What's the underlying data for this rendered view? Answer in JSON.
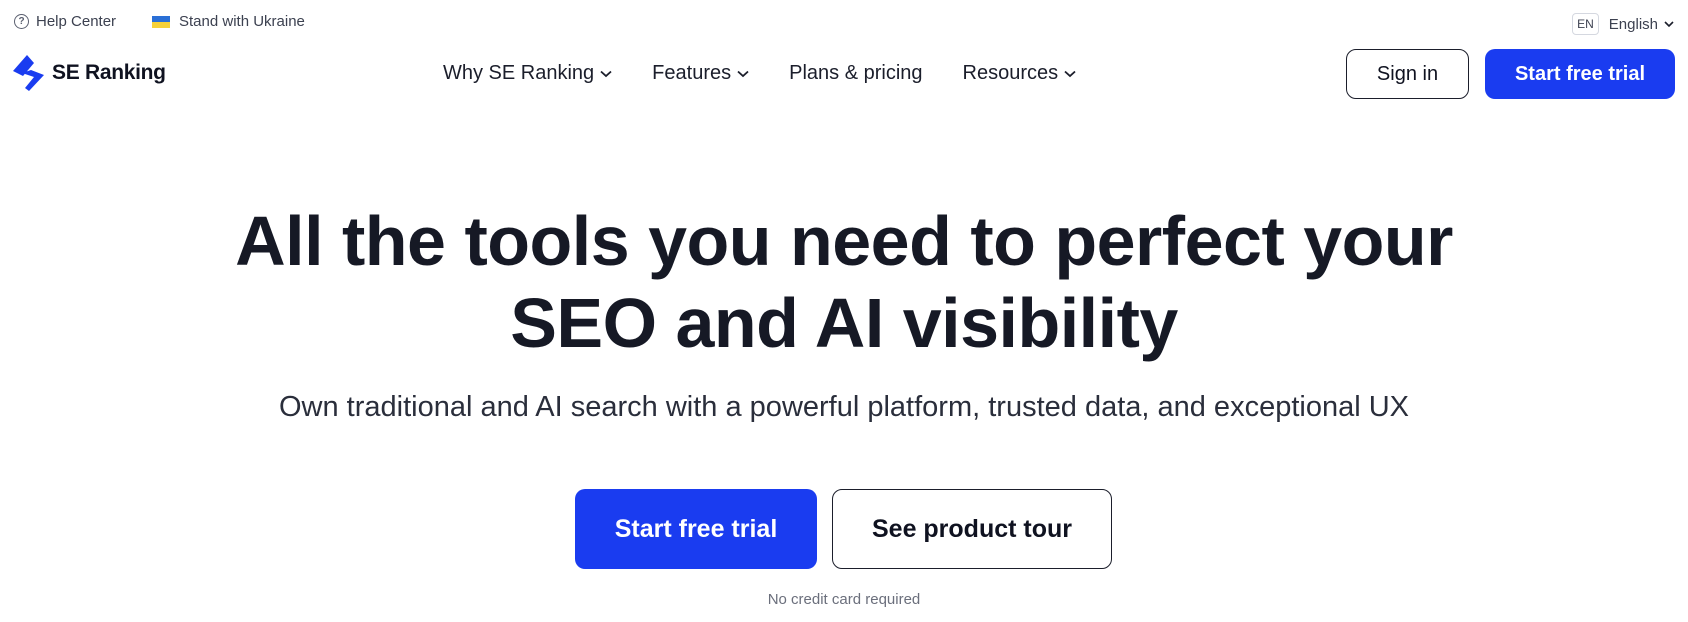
{
  "topbar": {
    "help_label": "Help Center",
    "ukraine_label": "Stand with Ukraine",
    "lang_code": "EN",
    "lang_label": "English"
  },
  "nav": {
    "logo_text": "SE Ranking",
    "items": [
      {
        "label": "Why SE Ranking",
        "has_dropdown": true
      },
      {
        "label": "Features",
        "has_dropdown": true
      },
      {
        "label": "Plans & pricing",
        "has_dropdown": false
      },
      {
        "label": "Resources",
        "has_dropdown": true
      }
    ],
    "signin_label": "Sign in",
    "trial_label": "Start free trial"
  },
  "hero": {
    "title_line1": "All the tools you need to perfect your",
    "title_line2": "SEO and AI visibility",
    "subtitle": "Own traditional and AI search with a powerful platform, trusted data, and exceptional UX",
    "cta_primary": "Start free trial",
    "cta_secondary": "See product tour",
    "note": "No credit card required"
  },
  "colors": {
    "accent": "#1a3cf0",
    "text": "#161925"
  }
}
